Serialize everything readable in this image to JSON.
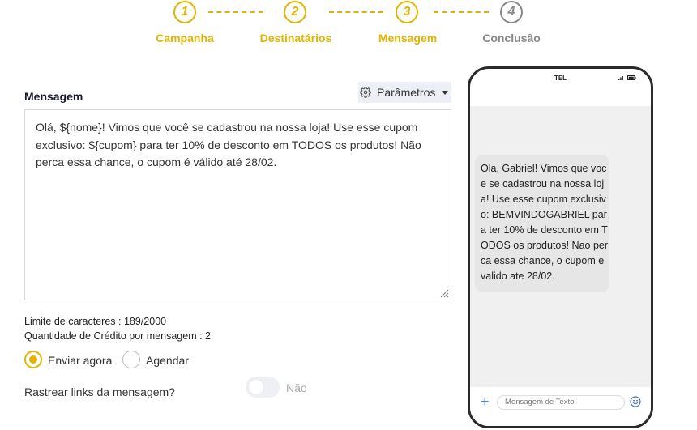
{
  "stepper": {
    "steps": [
      {
        "number": "1",
        "label": "Campanha",
        "active": true
      },
      {
        "number": "2",
        "label": "Destinatários",
        "active": true
      },
      {
        "number": "3",
        "label": "Mensagem",
        "active": true
      },
      {
        "number": "4",
        "label": "Conclusão",
        "active": false
      }
    ],
    "colors": {
      "active": "#e0b400",
      "inactive": "#888888"
    }
  },
  "form": {
    "section_title": "Mensagem",
    "params_button": {
      "label": "Parâmetros",
      "icon": "gear-icon"
    },
    "message_text": "Olá, ${nome}! Vimos que você se cadastrou na nossa loja! Use esse cupom exclusivo: ${cupom} para ter 10% de desconto em TODOS os produtos! Não perca essa chance, o cupom é válido até 28/02.",
    "char_limit": "Limite de caracteres : 189/2000",
    "credit_qty": "Quantidade de Crédito por mensagem : 2",
    "send_options": [
      {
        "label": "Enviar agora",
        "checked": true
      },
      {
        "label": "Agendar",
        "checked": false
      }
    ],
    "track_links": {
      "label": "Rastrear links da mensagem?",
      "toggle_text": "Não",
      "enabled": false
    }
  },
  "phone": {
    "carrier": "TEL",
    "preview_text": "Ola, Gabriel! Vimos que voce se cadastrou na nossa loja! Use esse cupom exclusivo: BEMVINDOGABRIEL para ter 10% de desconto em TODOS os produtos! Nao perca essa chance, o cupom e valido ate 28/02.",
    "compose_placeholder": "Mensagem de Texto"
  }
}
